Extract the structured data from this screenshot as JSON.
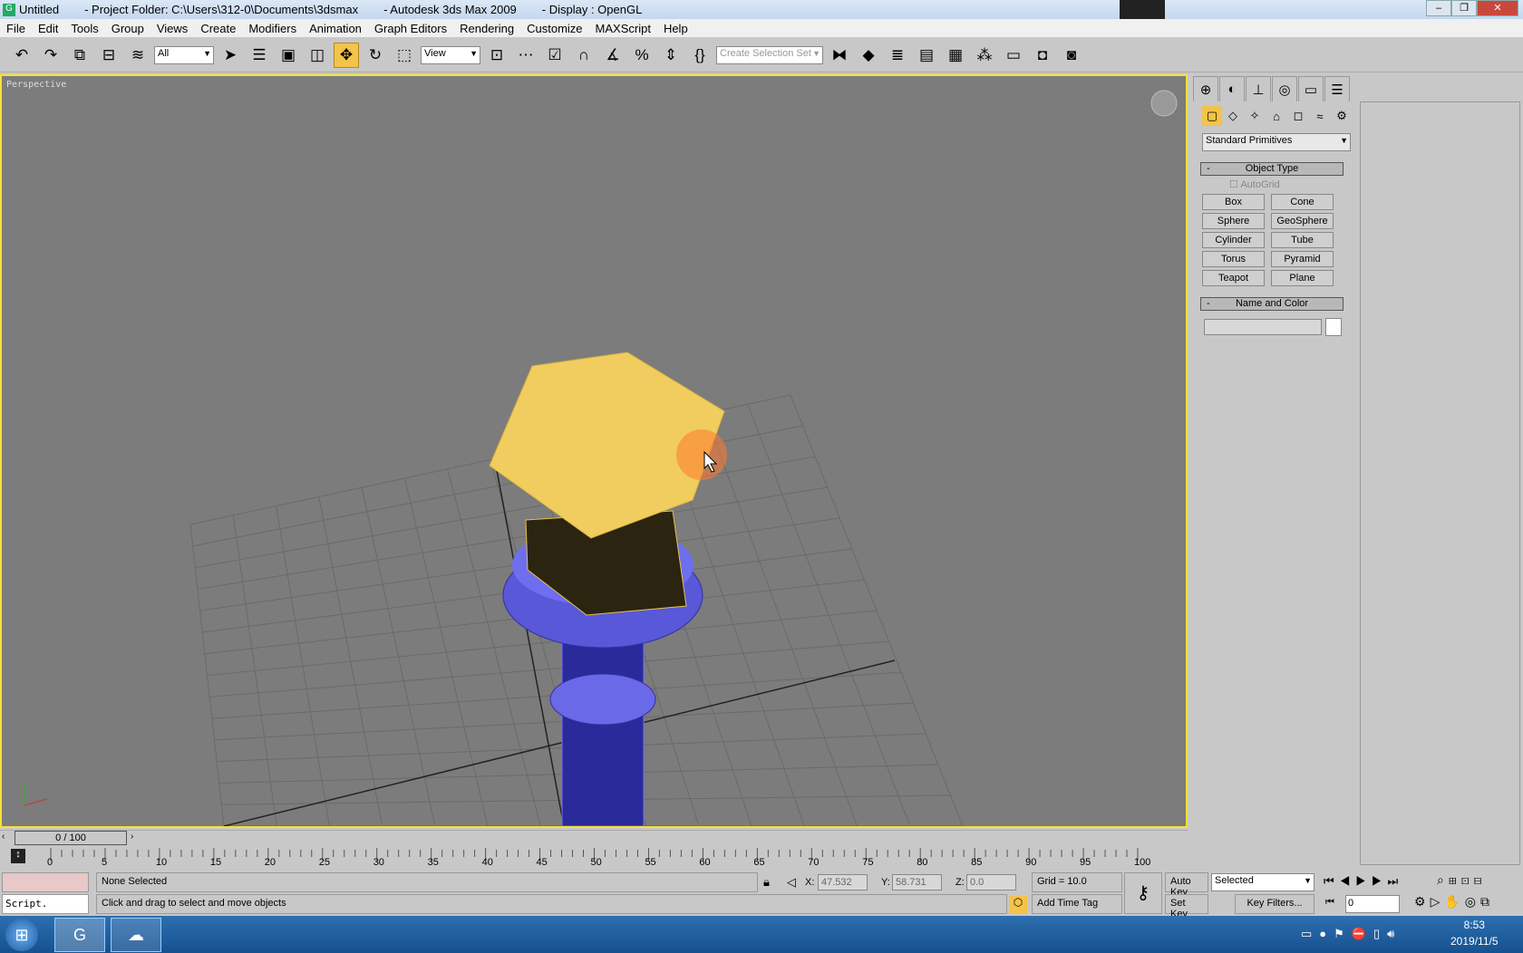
{
  "titlebar": {
    "doc": "Untitled",
    "project": "- Project Folder: C:\\Users\\312-0\\Documents\\3dsmax",
    "app": "- Autodesk 3ds Max  2009",
    "display": "- Display : OpenGL"
  },
  "menu": [
    "File",
    "Edit",
    "Tools",
    "Group",
    "Views",
    "Create",
    "Modifiers",
    "Animation",
    "Graph Editors",
    "Rendering",
    "Customize",
    "MAXScript",
    "Help"
  ],
  "toolbar": {
    "filter": "All",
    "ref_coord": "View",
    "selection_set_placeholder": "Create Selection Set",
    "active_tool": "select-and-move"
  },
  "viewport": {
    "label": "Perspective",
    "border_color": "#f7e232"
  },
  "command_panel": {
    "category": "Standard Primitives",
    "object_type_title": "Object Type",
    "autogrid": "AutoGrid",
    "buttons": [
      "Box",
      "Cone",
      "Sphere",
      "GeoSphere",
      "Cylinder",
      "Tube",
      "Torus",
      "Pyramid",
      "Teapot",
      "Plane"
    ],
    "name_color_title": "Name and Color",
    "collapse": "-"
  },
  "timeline": {
    "frame": "0 / 100",
    "ticks": [
      "0",
      "5",
      "10",
      "15",
      "20",
      "25",
      "30",
      "35",
      "40",
      "45",
      "50",
      "55",
      "60",
      "65",
      "70",
      "75",
      "80",
      "85",
      "90",
      "95",
      "100"
    ]
  },
  "status": {
    "script": "Script.",
    "selection": "None Selected",
    "prompt": "Click and drag to select and move objects",
    "x_label": "X:",
    "x": "47.532",
    "y_label": "Y:",
    "y": "58.731",
    "z_label": "Z:",
    "z": "0.0",
    "grid": "Grid = 10.0",
    "add_time_tag": "Add Time Tag",
    "auto_key": "Auto Key",
    "set_key": "Set Key",
    "key_mode": "Selected",
    "key_filters": "Key Filters...",
    "current_frame": "0"
  },
  "taskbar": {
    "time": "8:53",
    "date": "2019/11/5"
  }
}
